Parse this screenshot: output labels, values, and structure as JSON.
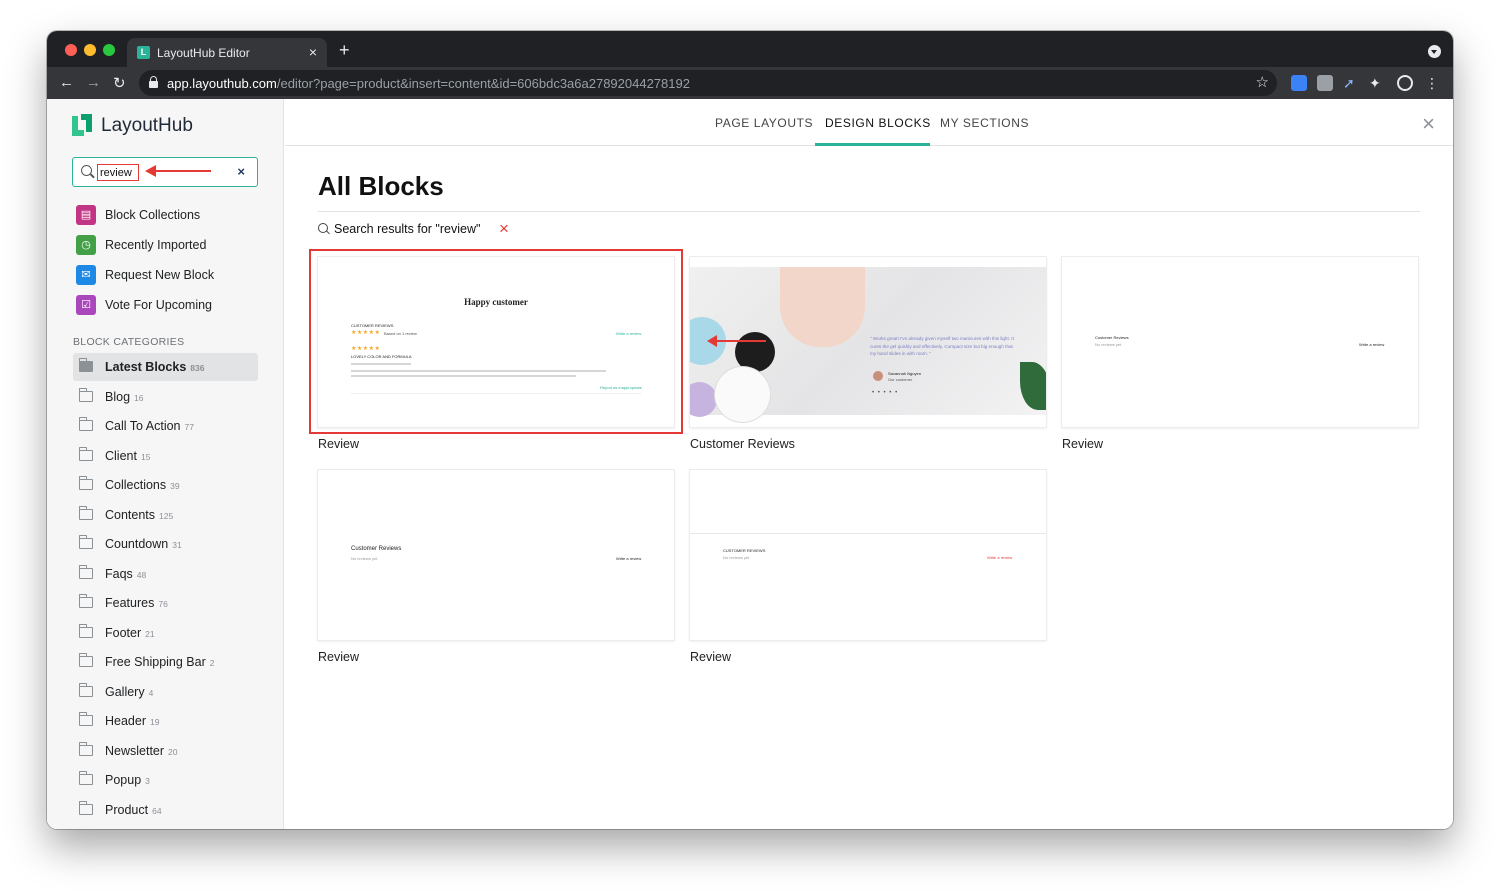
{
  "browser": {
    "tab_title": "LayoutHub Editor",
    "tab_close": "×",
    "new_tab": "+",
    "url_host": "app.layouthub.com",
    "url_path": "/editor?page=product&insert=content&id=606bdc3a6a27892044278192",
    "bookmark_star": "☆"
  },
  "sidebar": {
    "logo_text": "LayoutHub",
    "search": {
      "value": "review",
      "clear": "×"
    },
    "menu": [
      {
        "label": "Block Collections",
        "icon": "book-icon",
        "color": "#c13584"
      },
      {
        "label": "Recently Imported",
        "icon": "clock-icon",
        "color": "#43a047"
      },
      {
        "label": "Request New Block",
        "icon": "mail-icon",
        "color": "#1e88e5"
      },
      {
        "label": "Vote For Upcoming",
        "icon": "checkbox-icon",
        "color": "#ab47bc"
      }
    ],
    "categories_heading": "BLOCK CATEGORIES",
    "categories": [
      {
        "label": "Latest Blocks",
        "count": "836",
        "active": true
      },
      {
        "label": "Blog",
        "count": "16"
      },
      {
        "label": "Call To Action",
        "count": "77"
      },
      {
        "label": "Client",
        "count": "15"
      },
      {
        "label": "Collections",
        "count": "39"
      },
      {
        "label": "Contents",
        "count": "125"
      },
      {
        "label": "Countdown",
        "count": "31"
      },
      {
        "label": "Faqs",
        "count": "48"
      },
      {
        "label": "Features",
        "count": "76"
      },
      {
        "label": "Footer",
        "count": "21"
      },
      {
        "label": "Free Shipping Bar",
        "count": "2"
      },
      {
        "label": "Gallery",
        "count": "4"
      },
      {
        "label": "Header",
        "count": "19"
      },
      {
        "label": "Newsletter",
        "count": "20"
      },
      {
        "label": "Popup",
        "count": "3"
      },
      {
        "label": "Product",
        "count": "64"
      }
    ]
  },
  "topnav": {
    "tabs": [
      "PAGE LAYOUTS",
      "DESIGN BLOCKS",
      "MY SECTIONS"
    ],
    "active_tab": "DESIGN BLOCKS",
    "close": "×"
  },
  "main": {
    "heading": "All Blocks",
    "results_text": "Search results for \"review\"",
    "results_clear": "×",
    "cards": [
      {
        "label": "Review",
        "thumb_title": "Happy customer",
        "thumb_sub": "CUSTOMER REVIEWS",
        "thumb_link": "Write a review",
        "thumb_item": "LOVELY COLOR AND FORMULA",
        "thumb_report": "Report as inappropriate",
        "thumb_based": "Based on 1 review"
      },
      {
        "label": "Customer Reviews",
        "thumb_quote": "\" Works great! I've already given myself two manicures with this light. It cures the gel quickly and effectively. Compact size but big enough that my hand slides in with room. \"",
        "thumb_name": "Savannah Nguyen",
        "thumb_role": "Our customer",
        "thumb_dots": "• • • • •"
      },
      {
        "label": "Review",
        "thumb_title": "Customer Reviews",
        "thumb_sub": "No reviews yet",
        "thumb_link": "Write a review"
      },
      {
        "label": "Review",
        "thumb_title": "Customer Reviews",
        "thumb_sub": "No reviews yet",
        "thumb_link": "Write a review"
      },
      {
        "label": "Review",
        "thumb_title": "CUSTOMER REVIEWS",
        "thumb_sub": "No reviews yet",
        "thumb_link": "Write a review"
      }
    ]
  },
  "colors": {
    "accent": "#2bb39a",
    "annotation": "#e53935"
  }
}
